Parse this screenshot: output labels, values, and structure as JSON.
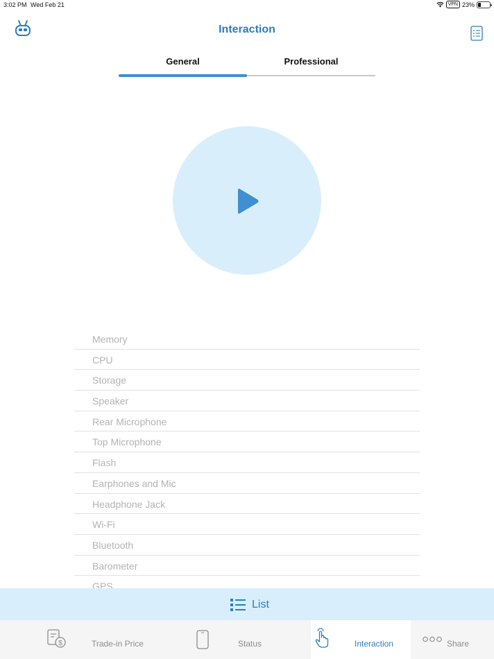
{
  "status_bar": {
    "time": "3:02 PM",
    "date": "Wed Feb 21",
    "vpn": "VPN",
    "battery": "23%",
    "battery_level": 0.23
  },
  "nav": {
    "title": "Interaction",
    "left_icon": "robot-logo-icon",
    "right_icon": "report-icon"
  },
  "segments": [
    {
      "label": "General",
      "active": true
    },
    {
      "label": "Professional",
      "active": false
    }
  ],
  "play": {
    "icon": "play-icon"
  },
  "tests": [
    "Memory",
    "CPU",
    "Storage",
    "Speaker",
    "Rear Microphone",
    "Top Microphone",
    "Flash",
    "Earphones and Mic",
    "Headphone Jack",
    "Wi-Fi",
    "Bluetooth",
    "Barometer",
    "GPS"
  ],
  "list_bar": {
    "label": "List",
    "icon": "list-icon"
  },
  "tabs": [
    {
      "label": "Trade-in Price",
      "icon": "price-document-icon",
      "active": false
    },
    {
      "label": "Status",
      "icon": "phone-icon",
      "active": false
    },
    {
      "label": "Interaction",
      "icon": "touch-hand-icon",
      "active": true
    },
    {
      "label": "Share",
      "icon": "more-dots-icon",
      "active": false
    }
  ],
  "colors": {
    "accent": "#2a7ebf",
    "accent_light": "#d8eefb",
    "play": "#3f8fd1",
    "muted_text": "#b3b3b3"
  }
}
